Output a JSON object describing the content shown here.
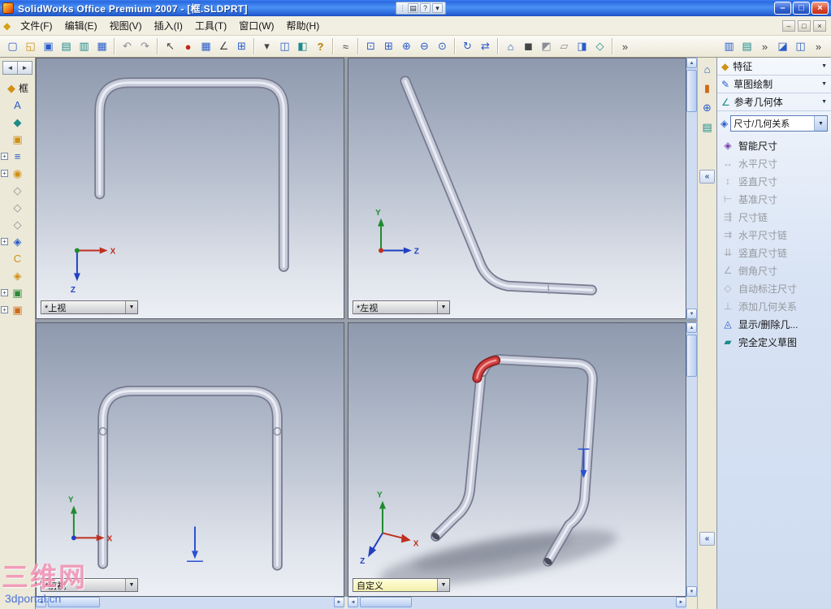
{
  "title_bar": {
    "title": "SolidWorks Office Premium 2007 - [框.SLDPRT]",
    "ime": {
      "grip": "⋮",
      "keyboard": "▤",
      "help": "?",
      "drop": "▾"
    },
    "minimize": "–",
    "restore": "□",
    "close": "×"
  },
  "menu_bar": {
    "doc_icon": "◆",
    "items": [
      "文件(F)",
      "编辑(E)",
      "视图(V)",
      "插入(I)",
      "工具(T)",
      "窗口(W)",
      "帮助(H)"
    ],
    "mdi": {
      "minimize": "–",
      "restore": "□",
      "close": "×"
    }
  },
  "toolbar": {
    "items": [
      {
        "name": "new-document",
        "glyph": "▢"
      },
      {
        "name": "open-document",
        "glyph": "◱"
      },
      {
        "name": "save",
        "glyph": "▣"
      },
      {
        "name": "make-drawing-from-part",
        "glyph": "▤"
      },
      {
        "name": "make-assembly-from-part",
        "glyph": "▥"
      },
      {
        "name": "print",
        "glyph": "▦"
      },
      {
        "name": "undo",
        "glyph": "↶"
      },
      {
        "name": "redo",
        "glyph": "↷"
      },
      {
        "name": "select",
        "glyph": "↖"
      },
      {
        "name": "rebuild",
        "glyph": "●"
      },
      {
        "name": "sketch",
        "glyph": "▦"
      },
      {
        "name": "dimension",
        "glyph": "∠"
      },
      {
        "name": "sketch-entities",
        "glyph": "⊞"
      },
      {
        "name": "features-dropdown",
        "glyph": "▾"
      },
      {
        "name": "display-mode-dropdown",
        "glyph": "◫"
      },
      {
        "name": "page-layout",
        "glyph": "◧"
      },
      {
        "name": "help",
        "glyph": "?"
      },
      {
        "name": "measure",
        "glyph": "≈"
      },
      {
        "name": "zoom-to-fit",
        "glyph": "⊡"
      },
      {
        "name": "zoom-to-area",
        "glyph": "⊞"
      },
      {
        "name": "zoom-in-out",
        "glyph": "⊕"
      },
      {
        "name": "zoom-out",
        "glyph": "⊖"
      },
      {
        "name": "zoom-to-selection",
        "glyph": "⊙"
      },
      {
        "name": "rotate-view",
        "glyph": "↻"
      },
      {
        "name": "pan",
        "glyph": "⇄"
      },
      {
        "name": "standard-views",
        "glyph": "⌂"
      },
      {
        "name": "shaded-with-edges",
        "glyph": "◼"
      },
      {
        "name": "hidden-lines-visible",
        "glyph": "◩"
      },
      {
        "name": "wireframe",
        "glyph": "▱"
      },
      {
        "name": "section-view",
        "glyph": "◨"
      },
      {
        "name": "view-orientation",
        "glyph": "◇"
      },
      {
        "name": "toolbar-overflow",
        "glyph": "»"
      },
      {
        "name": "feature-manager-toggle",
        "glyph": "▥"
      },
      {
        "name": "document-properties",
        "glyph": "▤"
      },
      {
        "name": "toolbar-overflow-2",
        "glyph": "»"
      },
      {
        "name": "window-tile",
        "glyph": "◪"
      },
      {
        "name": "window-cascade",
        "glyph": "◫"
      },
      {
        "name": "toolbar-overflow-3",
        "glyph": "»"
      }
    ]
  },
  "left_tree": {
    "nav_prev": "◄",
    "nav_next": "►",
    "items": [
      {
        "name": "part-root",
        "glyph": "◆",
        "label": "框"
      },
      {
        "name": "annotations",
        "glyph": "A"
      },
      {
        "name": "design-binder",
        "glyph": "◆"
      },
      {
        "name": "lighting",
        "glyph": "▣"
      },
      {
        "name": "equations",
        "glyph": "≡"
      },
      {
        "name": "material",
        "glyph": "◉"
      },
      {
        "name": "front-plane",
        "glyph": "◇"
      },
      {
        "name": "top-plane",
        "glyph": "◇"
      },
      {
        "name": "right-plane",
        "glyph": "◇"
      },
      {
        "name": "origin",
        "glyph": "◈"
      },
      {
        "name": "sweep-feature",
        "glyph": "C"
      },
      {
        "name": "sketch-plane",
        "glyph": "◈"
      },
      {
        "name": "sketch-1",
        "glyph": "▣"
      },
      {
        "name": "sketch-2",
        "glyph": "▣"
      }
    ]
  },
  "viewports": [
    {
      "label": "*上视",
      "axes": [
        "X",
        "Z"
      ]
    },
    {
      "label": "*左视",
      "axes": [
        "Y",
        "Z"
      ]
    },
    {
      "label": "*前视",
      "axes": [
        "Y",
        "X"
      ]
    },
    {
      "label": "自定义",
      "axes": [
        "Y",
        "X",
        "Z"
      ]
    }
  ],
  "right_strip": {
    "icons": [
      {
        "name": "home-view",
        "glyph": "⌂"
      },
      {
        "name": "appearance",
        "glyph": "▮"
      },
      {
        "name": "zoom-tool",
        "glyph": "⊕"
      },
      {
        "name": "sheet-set",
        "glyph": "▤"
      }
    ]
  },
  "task_panel": {
    "groups": [
      {
        "name": "features",
        "label": "特征",
        "glyph": "◆"
      },
      {
        "name": "sketch",
        "label": "草图绘制",
        "glyph": "✎"
      },
      {
        "name": "reference-geometry",
        "label": "参考几何体",
        "glyph": "∠"
      }
    ],
    "combo": {
      "glyph": "◈",
      "value": "尺寸/几何关系"
    },
    "items": [
      {
        "name": "smart-dimension",
        "label": "智能尺寸",
        "glyph": "◈",
        "enabled": true
      },
      {
        "name": "horizontal-dimension",
        "label": "水平尺寸",
        "glyph": "↔",
        "enabled": false
      },
      {
        "name": "vertical-dimension",
        "label": "竖直尺寸",
        "glyph": "↕",
        "enabled": false
      },
      {
        "name": "baseline-dimension",
        "label": "基准尺寸",
        "glyph": "⊢",
        "enabled": false
      },
      {
        "name": "ordinate-dimension",
        "label": "尺寸链",
        "glyph": "⇶",
        "enabled": false
      },
      {
        "name": "horizontal-ordinate",
        "label": "水平尺寸链",
        "glyph": "⇉",
        "enabled": false
      },
      {
        "name": "vertical-ordinate",
        "label": "竖直尺寸链",
        "glyph": "⇊",
        "enabled": false
      },
      {
        "name": "chamfer-dimension",
        "label": "倒角尺寸",
        "glyph": "∠",
        "enabled": false
      },
      {
        "name": "autodimension",
        "label": "自动标注尺寸",
        "glyph": "◇",
        "enabled": false
      },
      {
        "name": "add-relation",
        "label": "添加几何关系",
        "glyph": "⊥",
        "enabled": false
      },
      {
        "name": "display-delete-relations",
        "label": "显示/删除几...",
        "glyph": "◬",
        "enabled": true
      },
      {
        "name": "fully-define-sketch",
        "label": "完全定义草图",
        "glyph": "▰",
        "enabled": true
      }
    ]
  },
  "watermark": {
    "line1": "三维网",
    "line2": "3dportal.cn"
  },
  "glyphs": {
    "up": "▲",
    "down": "▼",
    "left": "◄",
    "right": "►",
    "collapse": "«",
    "plus": "+",
    "dropdown": "▼"
  }
}
